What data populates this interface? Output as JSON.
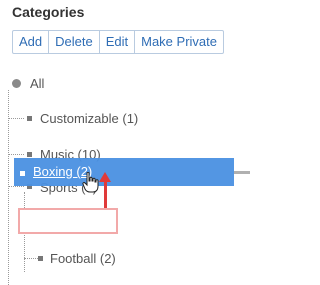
{
  "panel": {
    "title": "Categories"
  },
  "toolbar": {
    "add_label": "Add",
    "delete_label": "Delete",
    "edit_label": "Edit",
    "make_private_label": "Make Private"
  },
  "tree": {
    "root_label": "All",
    "items": [
      {
        "label": "Customizable (1)"
      },
      {
        "label": "Music (10)"
      },
      {
        "label": "Sports (6)"
      },
      {
        "label": "Football (2)"
      }
    ],
    "dragged_item": {
      "label": "Boxing (2)"
    }
  },
  "colors": {
    "accent": "#4a90e2",
    "link": "#2f6db5",
    "arrow": "#e03a3a",
    "drop_target_border": "#f2a9a9"
  },
  "icons": {
    "root": "circle-node-icon",
    "item": "square-node-icon",
    "cursor": "hand-cursor-icon",
    "arrow": "up-arrow-icon"
  }
}
